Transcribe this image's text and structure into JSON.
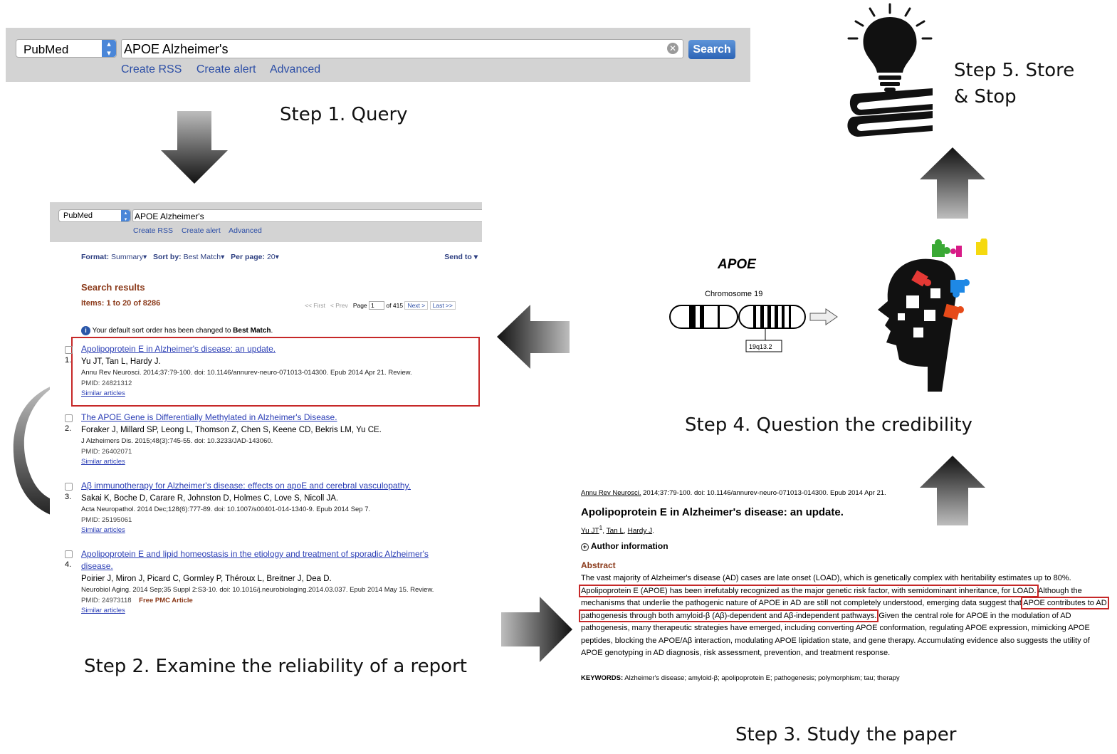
{
  "steps": {
    "step1": "Step 1. Query",
    "step2": "Step 2. Examine the reliability of a report",
    "step3": "Step 3. Study the paper",
    "step4": "Step 4. Question the credibility",
    "step5_line1": "Step 5. Store",
    "step5_line2": "& Stop"
  },
  "top_search": {
    "database": "PubMed",
    "query": "APOE Alzheimer's",
    "search_button": "Search",
    "links": [
      "Create RSS",
      "Create alert",
      "Advanced"
    ]
  },
  "results_page": {
    "database": "PubMed",
    "query": "APOE Alzheimer's",
    "links": [
      "Create RSS",
      "Create alert",
      "Advanced"
    ],
    "format_label": "Format:",
    "format_value": "Summary",
    "sort_label": "Sort by:",
    "sort_value": "Best Match",
    "perpage_label": "Per page:",
    "perpage_value": "20",
    "send_to": "Send to",
    "heading": "Search results",
    "items_count": "Items: 1 to 20 of 8286",
    "pager": {
      "first": "<< First",
      "prev": "< Prev",
      "page_label": "Page",
      "page_value": "1",
      "of": "of 415",
      "next": "Next >",
      "last": "Last >>"
    },
    "notice_prefix": "Your default sort order has been changed to",
    "notice_bold": "Best Match",
    "items": [
      {
        "num": "1.",
        "title": "Apolipoprotein E in Alzheimer's disease: an update.",
        "authors": "Yu JT, Tan L, Hardy J.",
        "citation": "Annu Rev Neurosci. 2014;37:79-100. doi: 10.1146/annurev-neuro-071013-014300. Epub 2014 Apr 21. Review.",
        "pmid": "PMID: 24821312",
        "similar": "Similar articles",
        "free": ""
      },
      {
        "num": "2.",
        "title": "The APOE Gene is Differentially Methylated in Alzheimer's Disease.",
        "authors": "Foraker J, Millard SP, Leong L, Thomson Z, Chen S, Keene CD, Bekris LM, Yu CE.",
        "citation": "J Alzheimers Dis. 2015;48(3):745-55. doi: 10.3233/JAD-143060.",
        "pmid": "PMID: 26402071",
        "similar": "Similar articles",
        "free": ""
      },
      {
        "num": "3.",
        "title": "Aβ immunotherapy for Alzheimer's disease: effects on apoE and cerebral vasculopathy.",
        "authors": "Sakai K, Boche D, Carare R, Johnston D, Holmes C, Love S, Nicoll JA.",
        "citation": "Acta Neuropathol. 2014 Dec;128(6):777-89. doi: 10.1007/s00401-014-1340-9. Epub 2014 Sep 7.",
        "pmid": "PMID: 25195061",
        "similar": "Similar articles",
        "free": ""
      },
      {
        "num": "4.",
        "title": "Apolipoprotein E and lipid homeostasis in the etiology and treatment of sporadic Alzheimer's disease.",
        "authors": "Poirier J, Miron J, Picard C, Gormley P, Théroux L, Breitner J, Dea D.",
        "citation": "Neurobiol Aging. 2014 Sep;35 Suppl 2:S3-10. doi: 10.1016/j.neurobiolaging.2014.03.037. Epub 2014 May 15. Review.",
        "pmid": "PMID: 24973118",
        "similar": "Similar articles",
        "free": "Free PMC Article"
      }
    ]
  },
  "gene_figure": {
    "gene": "APOE",
    "chromosome": "Chromosome 19",
    "locus": "19q13.2"
  },
  "abstract_page": {
    "citation_journal": "Annu Rev Neurosci.",
    "citation_rest": "2014;37:79-100. doi: 10.1146/annurev-neuro-071013-014300. Epub 2014 Apr 21.",
    "title": "Apolipoprotein E in Alzheimer's disease: an update.",
    "authors": [
      "Yu JT",
      "Tan L",
      "Hardy J"
    ],
    "author_sup": "1",
    "author_info": "Author information",
    "abstract_heading": "Abstract",
    "text_1": "The vast majority of Alzheimer's disease (AD) cases are late onset (LOAD), which is genetically complex with heritability estimates up to 80%.",
    "highlight_1": "Apolipoprotein E (APOE) has been irrefutably recognized as the major genetic risk factor, with semidominant inheritance, for LOAD.",
    "text_2": "Although the mechanisms that underlie the pathogenic nature of APOE in AD are still not completely understood, emerging data suggest that",
    "highlight_2": "APOE contributes to AD pathogenesis through both amyloid-β (Aβ)-dependent and Aβ-independent pathways.",
    "text_3": "Given the central role for APOE in the modulation of AD pathogenesis, many therapeutic strategies have emerged, including converting APOE conformation, regulating APOE expression, mimicking APOE peptides, blocking the APOE/Aβ interaction, modulating APOE lipidation state, and gene therapy. Accumulating evidence also suggests the utility of APOE genotyping in AD diagnosis, risk assessment, prevention, and treatment response.",
    "keywords_label": "KEYWORDS:",
    "keywords": "Alzheimer's disease; amyloid-β; apolipoprotein E; pathogenesis; polymorphism; tau; therapy"
  },
  "colors": {
    "link_blue": "#2b3eb5",
    "highlight_red": "#c62828",
    "heading_brown": "#8b3a1a",
    "bar_gray": "#d3d3d3",
    "arrow_dark": "#1a1a1a"
  }
}
